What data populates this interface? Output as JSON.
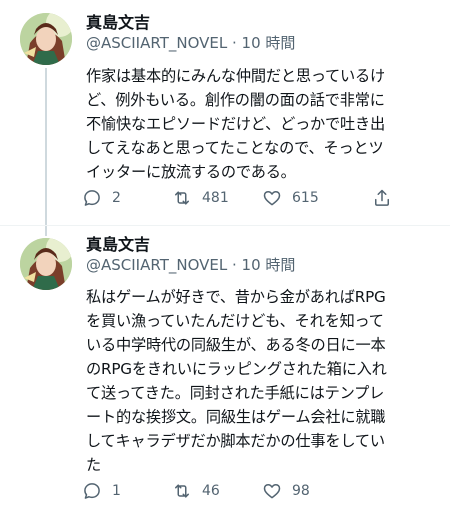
{
  "tweets": [
    {
      "author_name": "真島文吉",
      "handle": "@ASCIIART_NOVEL",
      "time": "· 10 時間",
      "text": "作家は基本的にみんな仲間だと思っているけ\nど、例外もいる。創作の闇の面の話で非常に\n不愉快なエピソードだけど、どっかで吐き出\nしてえなあと思ってたことなので、そっとツ\nイッターに放流するのである。",
      "replies": "2",
      "retweets": "481",
      "likes": "615"
    },
    {
      "author_name": "真島文吉",
      "handle": "@ASCIIART_NOVEL",
      "time": "· 10 時間",
      "text": "私はゲームが好きで、昔から金があればRPG\nを買い漁っていたんだけども、それを知って\nいる中学時代の同級生が、ある冬の日に一本\nのRPGをきれいにラッピングされた箱に入れ\nて送ってきた。同封された手紙にはテンプレ\nート的な挨拶文。同級生はゲーム会社に就職\nしてキャラデザだか脚本だかの仕事をしてい\nた",
      "replies": "1",
      "retweets": "46",
      "likes": "98"
    }
  ],
  "colors": {
    "secondary_text": "#536471",
    "thread_line": "#cfd9de"
  }
}
